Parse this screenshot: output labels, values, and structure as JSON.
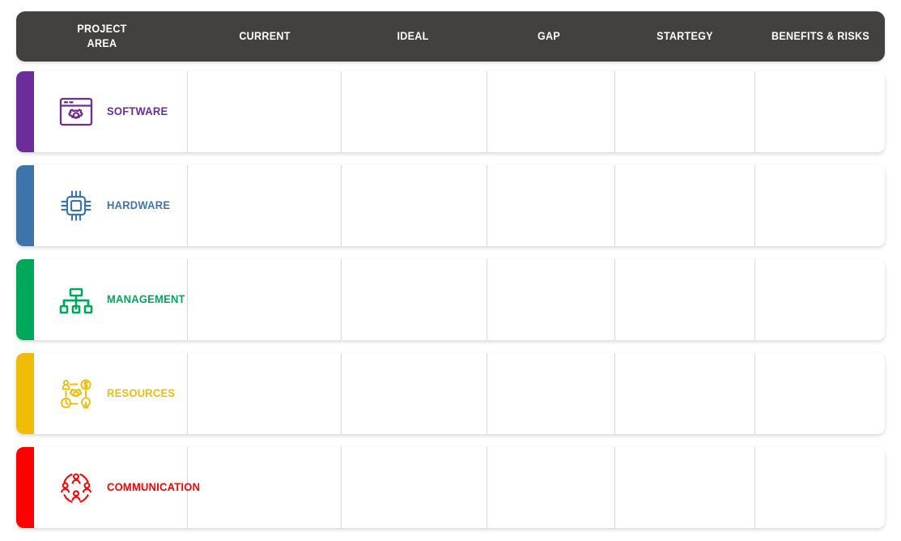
{
  "header": {
    "columns": [
      {
        "id": "project-area",
        "label": "PROJECT\nAREA"
      },
      {
        "id": "current",
        "label": "CURRENT"
      },
      {
        "id": "ideal",
        "label": "IDEAL"
      },
      {
        "id": "gap",
        "label": "GAP"
      },
      {
        "id": "strategy",
        "label": "STARTEGY"
      },
      {
        "id": "benefits-risks",
        "label": "BENEFITS & RISKS"
      }
    ],
    "background_color": "#434040",
    "text_color": "#ffffff"
  },
  "rows": [
    {
      "id": "software",
      "label": "SOFTWARE",
      "icon": "browser-gear-icon",
      "color": "#6B2D99",
      "cells": {
        "current": "",
        "ideal": "",
        "gap": "",
        "strategy": "",
        "benefits_risks": ""
      }
    },
    {
      "id": "hardware",
      "label": "HARDWARE",
      "icon": "cpu-chip-icon",
      "color": "#3D75AB",
      "cells": {
        "current": "",
        "ideal": "",
        "gap": "",
        "strategy": "",
        "benefits_risks": ""
      }
    },
    {
      "id": "management",
      "label": "MANAGEMENT",
      "icon": "org-chart-icon",
      "color": "#00A859",
      "cells": {
        "current": "",
        "ideal": "",
        "gap": "",
        "strategy": "",
        "benefits_risks": ""
      }
    },
    {
      "id": "resources",
      "label": "RESOURCES",
      "icon": "resources-gear-network-icon",
      "color": "#EFBD06",
      "cells": {
        "current": "",
        "ideal": "",
        "gap": "",
        "strategy": "",
        "benefits_risks": ""
      }
    },
    {
      "id": "communication",
      "label": "COMMUNICATION",
      "icon": "people-circle-icon",
      "color": "#FF0000",
      "cells": {
        "current": "",
        "ideal": "",
        "gap": "",
        "strategy": "",
        "benefits_risks": ""
      }
    }
  ],
  "style": {
    "cell_divider_color": "#d8d8d8",
    "page_background": "#ffffff"
  }
}
